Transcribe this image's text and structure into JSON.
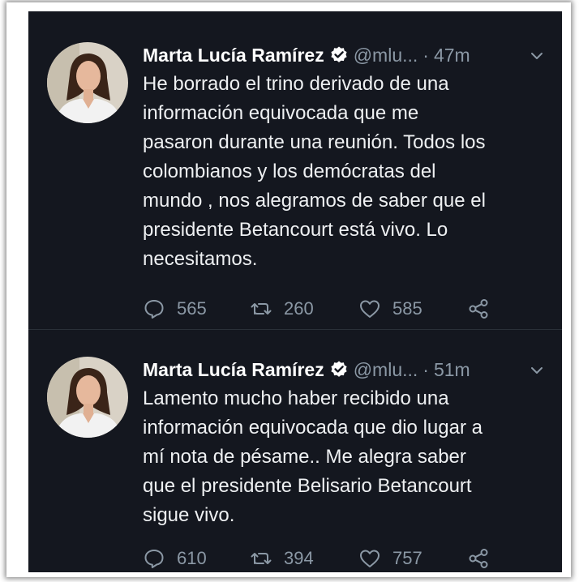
{
  "tweets": [
    {
      "author_name": "Marta Lucía Ramírez",
      "handle": "@mlu...",
      "separator": "·",
      "time": "47m",
      "text": "He borrado el trino derivado de una\ninformación equivocada que me\npasaron durante una reunión. Todos los\ncolombianos y los demócratas del\nmundo , nos alegramos de saber que el\npresidente Betancourt está vivo. Lo\nnecesitamos.",
      "replies": "565",
      "retweets": "260",
      "likes": "585"
    },
    {
      "author_name": "Marta Lucía Ramírez",
      "handle": "@mlu...",
      "separator": "·",
      "time": "51m",
      "text": "Lamento mucho haber recibido una\ninformación equivocada que dio lugar a\nmí nota de pésame.. Me alegra saber\nque el presidente Belisario Betancourt\nsigue vivo.",
      "replies": "610",
      "retweets": "394",
      "likes": "757"
    }
  ],
  "colors": {
    "background": "#14171f",
    "text": "#eef0f2",
    "muted": "#8b98a5",
    "verified": "#ffffff"
  },
  "icons": [
    "verified-badge-icon",
    "chevron-down-icon",
    "reply-icon",
    "retweet-icon",
    "like-icon",
    "share-icon"
  ]
}
